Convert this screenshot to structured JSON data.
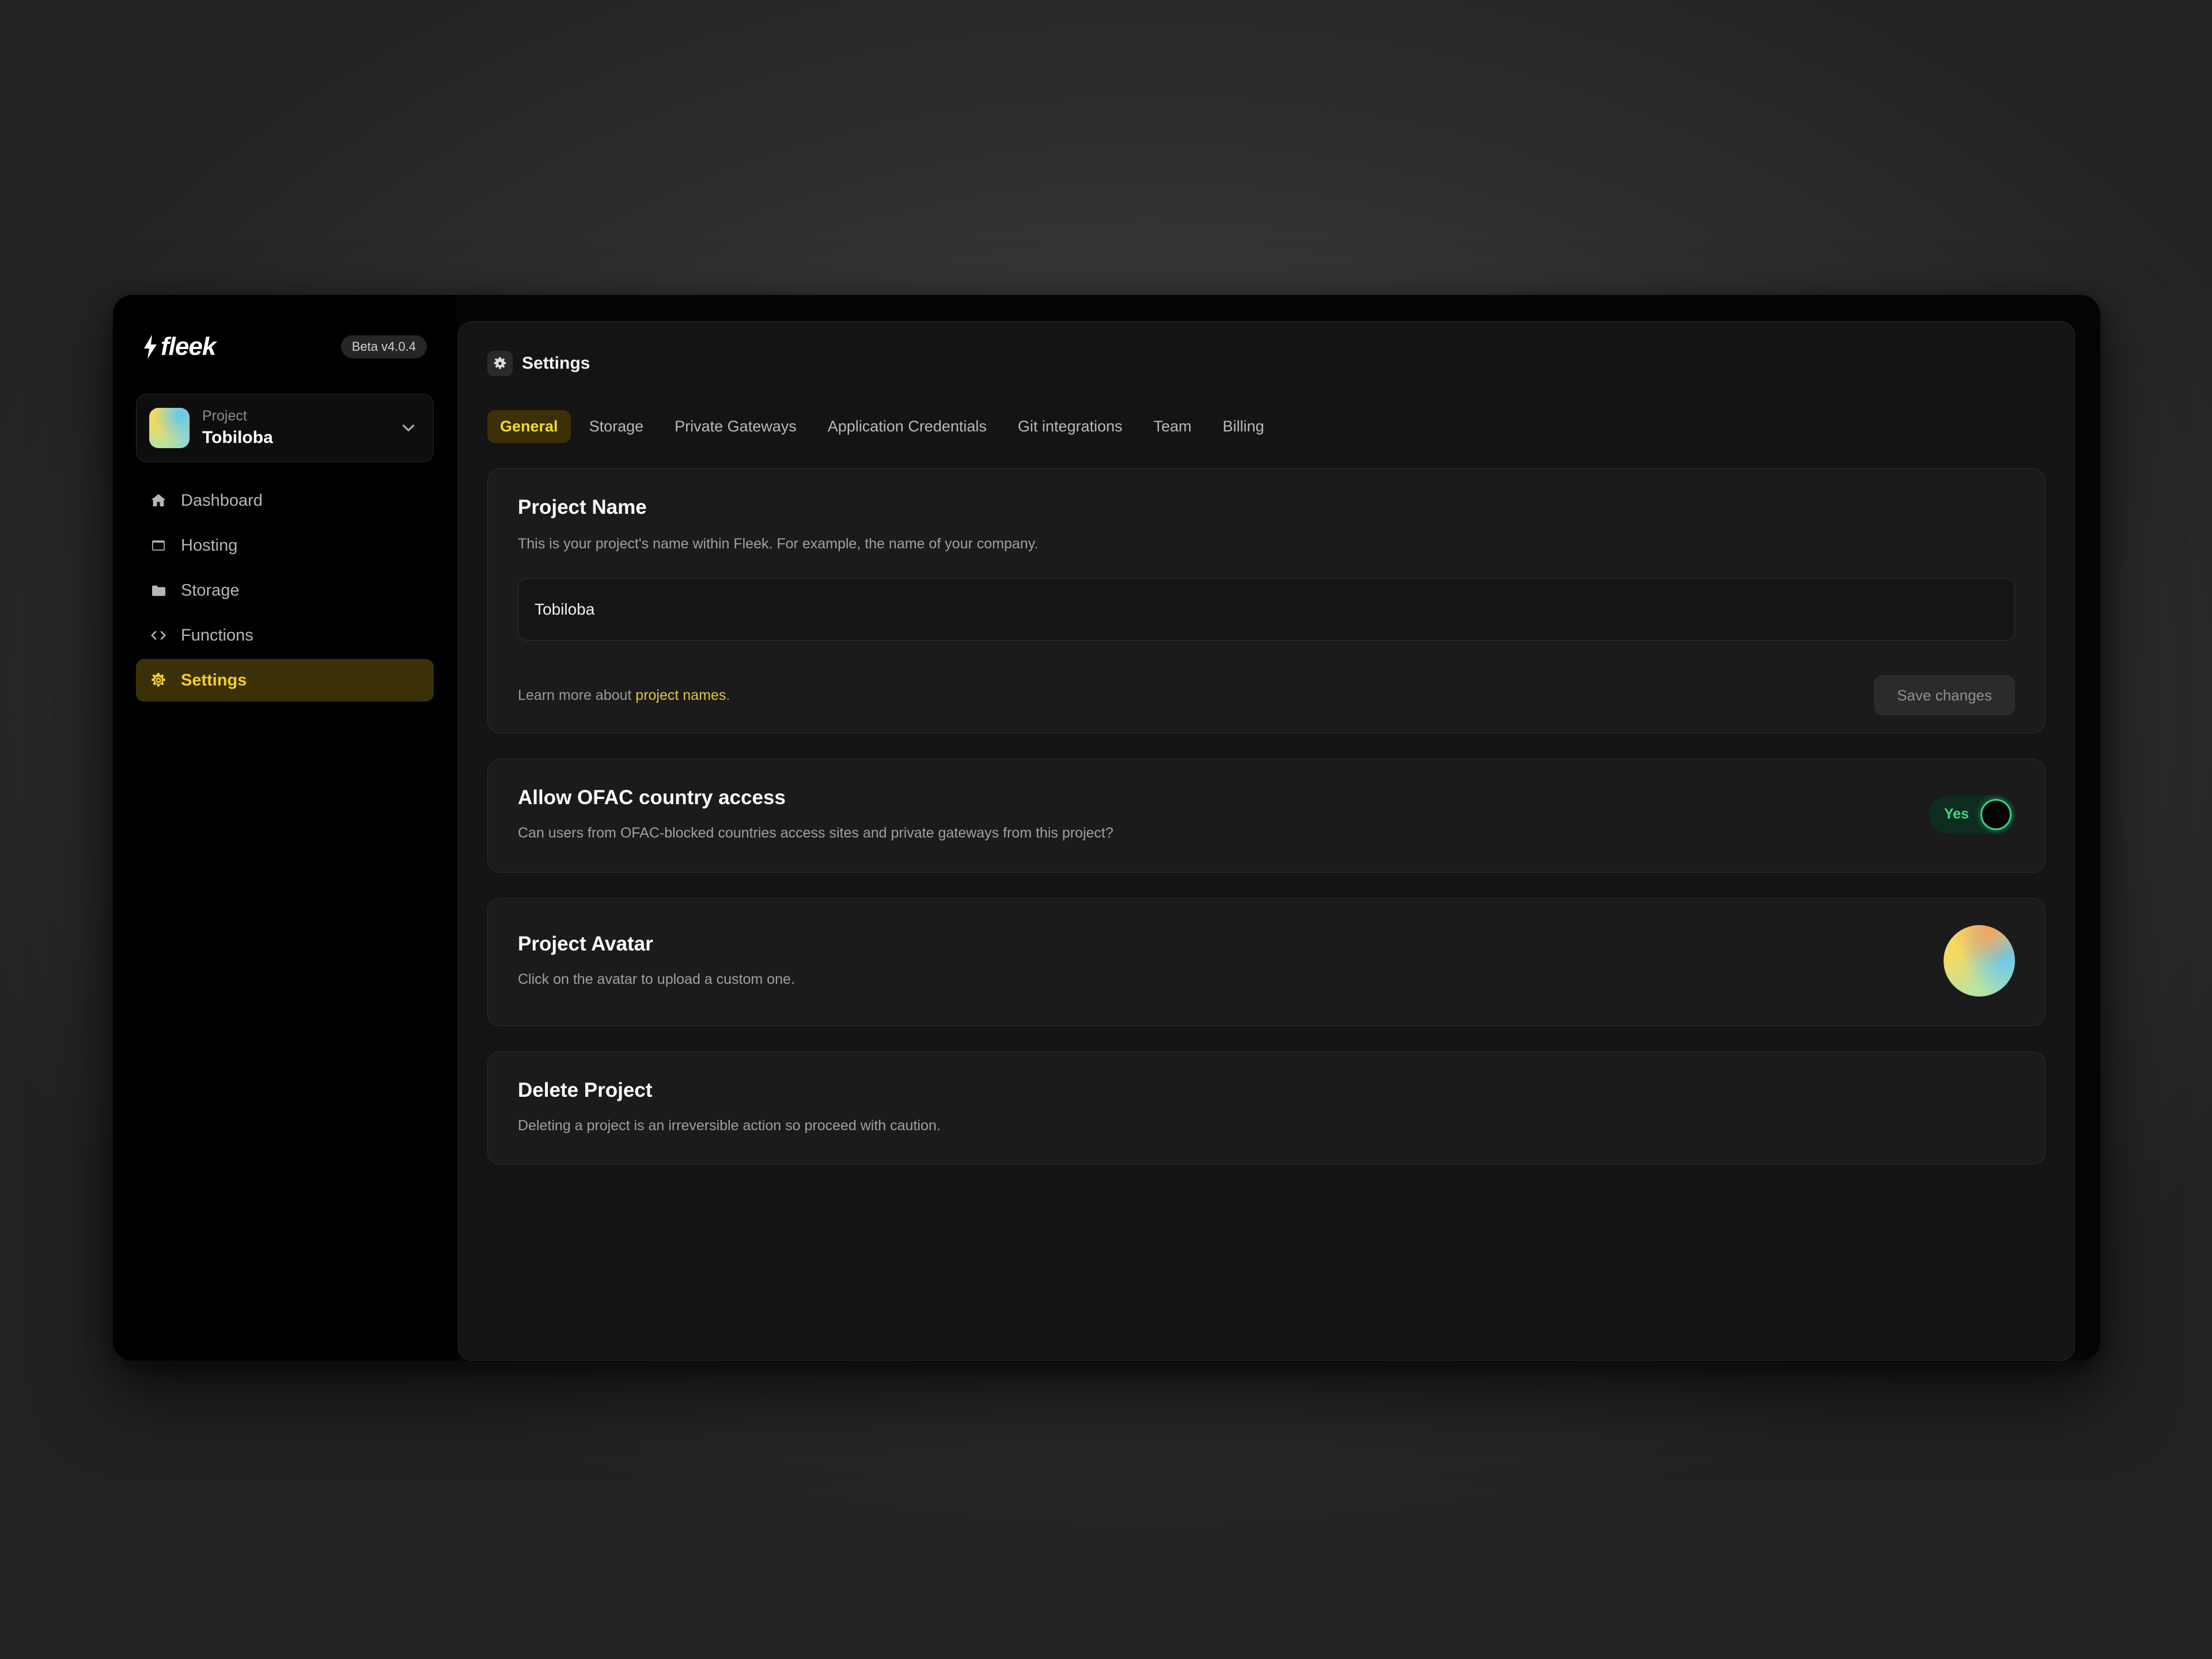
{
  "sidebar": {
    "logo_text": "fleek",
    "logo_icon": "lightning-bolt-icon",
    "beta_badge": "Beta v4.0.4",
    "project_selector": {
      "label": "Project",
      "name": "Tobiloba",
      "chevron_icon": "chevron-down-icon"
    },
    "items": [
      {
        "label": "Dashboard",
        "icon": "home-icon",
        "active": false
      },
      {
        "label": "Hosting",
        "icon": "window-icon",
        "active": false
      },
      {
        "label": "Storage",
        "icon": "folder-icon",
        "active": false
      },
      {
        "label": "Functions",
        "icon": "code-brackets-icon",
        "active": false
      },
      {
        "label": "Settings",
        "icon": "gear-icon",
        "active": true
      }
    ]
  },
  "header": {
    "title": "Settings",
    "icon": "gear-icon"
  },
  "tabs": [
    {
      "label": "General",
      "active": true
    },
    {
      "label": "Storage",
      "active": false
    },
    {
      "label": "Private Gateways",
      "active": false
    },
    {
      "label": "Application Credentials",
      "active": false
    },
    {
      "label": "Git integrations",
      "active": false
    },
    {
      "label": "Team",
      "active": false
    },
    {
      "label": "Billing",
      "active": false
    }
  ],
  "cards": {
    "project_name": {
      "title": "Project Name",
      "description": "This is your project's name within Fleek. For example, the name of your company.",
      "input_value": "Tobiloba",
      "input_placeholder": "Project name",
      "footer_text_prefix": "Learn more about ",
      "footer_link": "project names",
      "footer_text_suffix": ".",
      "save_label": "Save changes"
    },
    "ofac": {
      "title": "Allow OFAC country access",
      "description": "Can users from OFAC-blocked countries access sites and private gateways from this project?",
      "toggle_value": "Yes",
      "toggle_on": true
    },
    "avatar": {
      "title": "Project Avatar",
      "description": "Click on the avatar to upload a custom one.",
      "avatar_icon": "project-avatar-gradient"
    },
    "delete": {
      "title": "Delete Project",
      "description": "Deleting a project is an irreversible action so proceed with caution."
    }
  },
  "colors": {
    "accent_yellow": "#f4dc2a",
    "accent_yellow_bg": "#3b3008",
    "toggle_green": "#3ddc84",
    "panel_bg": "#141414",
    "card_bg": "#1b1b1b",
    "sidebar_bg": "#000000"
  }
}
